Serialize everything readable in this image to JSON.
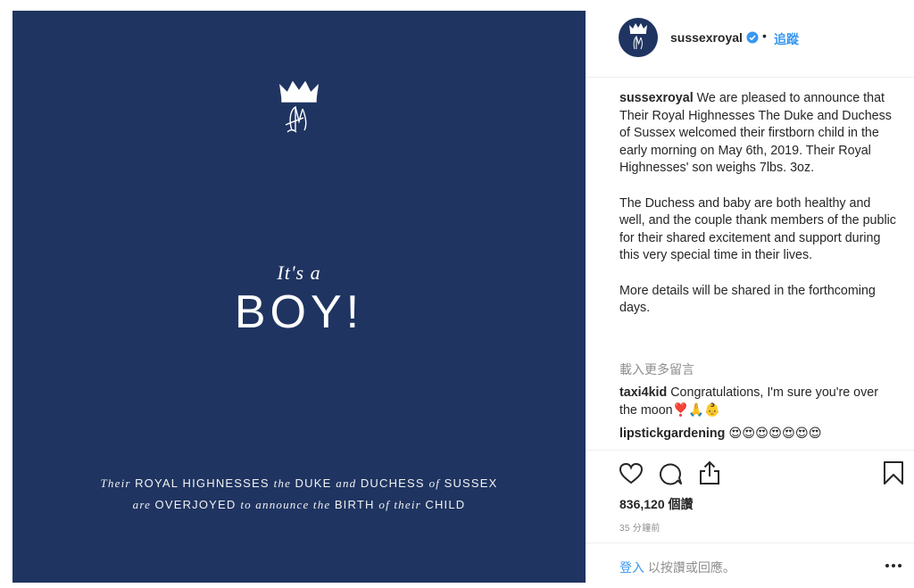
{
  "post": {
    "its_a": "It's a",
    "boy": "BOY!",
    "line1": [
      {
        "text": "Their ",
        "style": "ital"
      },
      {
        "text": "ROYAL HIGHNESSES ",
        "style": "caps"
      },
      {
        "text": "the ",
        "style": "ital"
      },
      {
        "text": "DUKE ",
        "style": "caps"
      },
      {
        "text": "and ",
        "style": "ital"
      },
      {
        "text": "DUCHESS ",
        "style": "caps"
      },
      {
        "text": "of ",
        "style": "ital"
      },
      {
        "text": "SUSSEX",
        "style": "caps"
      }
    ],
    "line2": [
      {
        "text": "are ",
        "style": "ital"
      },
      {
        "text": "OVERJOYED ",
        "style": "caps"
      },
      {
        "text": "to announce the ",
        "style": "ital"
      },
      {
        "text": "BIRTH ",
        "style": "caps"
      },
      {
        "text": "of their ",
        "style": "ital"
      },
      {
        "text": "CHILD",
        "style": "caps"
      }
    ],
    "background_color": "#1f3461"
  },
  "header": {
    "username": "sussexroyal",
    "separator": "•",
    "follow_label": "追蹤"
  },
  "caption": {
    "username": "sussexroyal",
    "para1": "We are pleased to announce that Their Royal Highnesses The Duke and Duchess of Sussex welcomed their firstborn child in the early morning on May 6th, 2019. Their Royal Highnesses' son weighs 7lbs. 3oz.",
    "para2": "The Duchess and baby are both healthy and well, and the couple thank members of the public for their shared excitement and support during this very special time in their lives.",
    "para3": "More details will be shared in the forthcoming days."
  },
  "load_more_label": "載入更多留言",
  "comments": [
    {
      "user": "taxi4kid",
      "text": "Congratulations, I'm sure you're over the moon❣️🙏👶"
    },
    {
      "user": "lipstickgardening",
      "text": "😍😍😍😍😍😍😍"
    }
  ],
  "likes": "836,120 個讚",
  "time": "35 分鐘前",
  "footer": {
    "login_link": "登入",
    "login_rest": " 以按讚或回應。"
  },
  "colors": {
    "accent": "#3897f0",
    "muted": "#8e8e8e"
  }
}
